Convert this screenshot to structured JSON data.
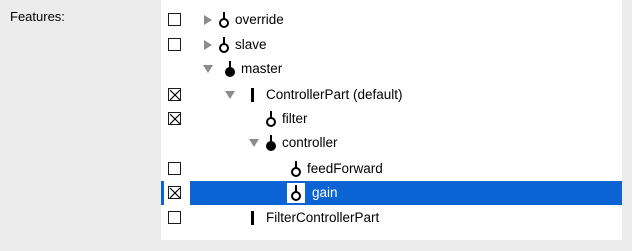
{
  "label": "Features:",
  "rows": [
    {
      "text": "override",
      "checkbox": "unchecked",
      "disclosure": "collapsed",
      "icon": "open-node-icon"
    },
    {
      "text": "slave",
      "checkbox": "unchecked",
      "disclosure": "collapsed",
      "icon": "open-node-icon"
    },
    {
      "text": "master",
      "checkbox": "none",
      "disclosure": "expanded",
      "icon": "filled-node-icon"
    },
    {
      "text": "ControllerPart (default)",
      "checkbox": "crossed",
      "disclosure": "expanded",
      "icon": "bar-icon"
    },
    {
      "text": "filter",
      "checkbox": "crossed",
      "disclosure": "none",
      "icon": "open-node-icon"
    },
    {
      "text": "controller",
      "checkbox": "none",
      "disclosure": "expanded",
      "icon": "filled-node-icon"
    },
    {
      "text": "feedForward",
      "checkbox": "unchecked",
      "disclosure": "none",
      "icon": "open-node-icon"
    },
    {
      "text": "gain",
      "checkbox": "crossed",
      "disclosure": "none",
      "icon": "open-node-icon",
      "selected": true
    },
    {
      "text": "FilterControllerPart",
      "checkbox": "unchecked",
      "disclosure": "none",
      "icon": "bar-icon"
    }
  ],
  "colors": {
    "selection": "#0b63d4",
    "background": "#ececec",
    "panel": "#ffffff"
  }
}
